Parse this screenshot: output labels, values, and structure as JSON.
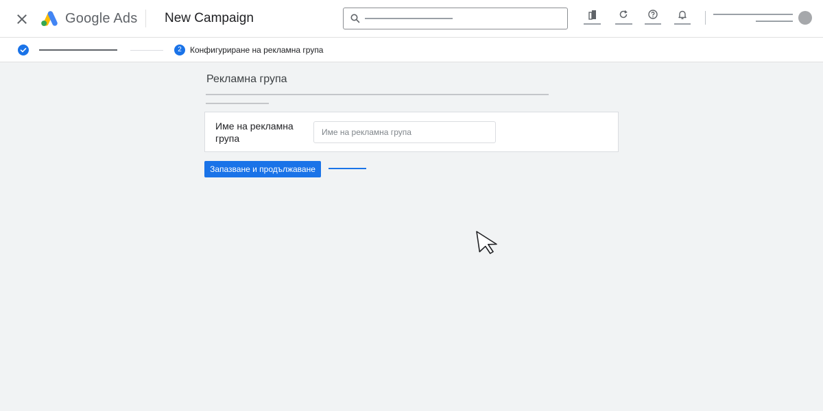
{
  "header": {
    "brand_name": "Google Ads",
    "page_title": "New Campaign",
    "close_icon": "close-icon",
    "logo_colors": {
      "blue": "#4285f4",
      "yellow": "#fbbc04",
      "green": "#34a853"
    },
    "search": {
      "icon": "search-icon",
      "placeholder": ""
    },
    "tools": [
      "building-icon",
      "refresh-icon",
      "help-icon",
      "bell-icon"
    ]
  },
  "stepper": {
    "steps": [
      {
        "status": "completed",
        "icon": "check-icon"
      },
      {
        "number": "2",
        "label": "Конфигуриране на рекламна група",
        "status": "current"
      }
    ]
  },
  "main": {
    "section_title": "Рекламна група",
    "ad_group_field": {
      "label": "Име на рекламна група",
      "placeholder": "Име на рекламна група",
      "value": ""
    },
    "save_button_label": "Запазване и продължаване"
  },
  "colors": {
    "accent": "#1a73e8",
    "background": "#f1f3f4"
  }
}
